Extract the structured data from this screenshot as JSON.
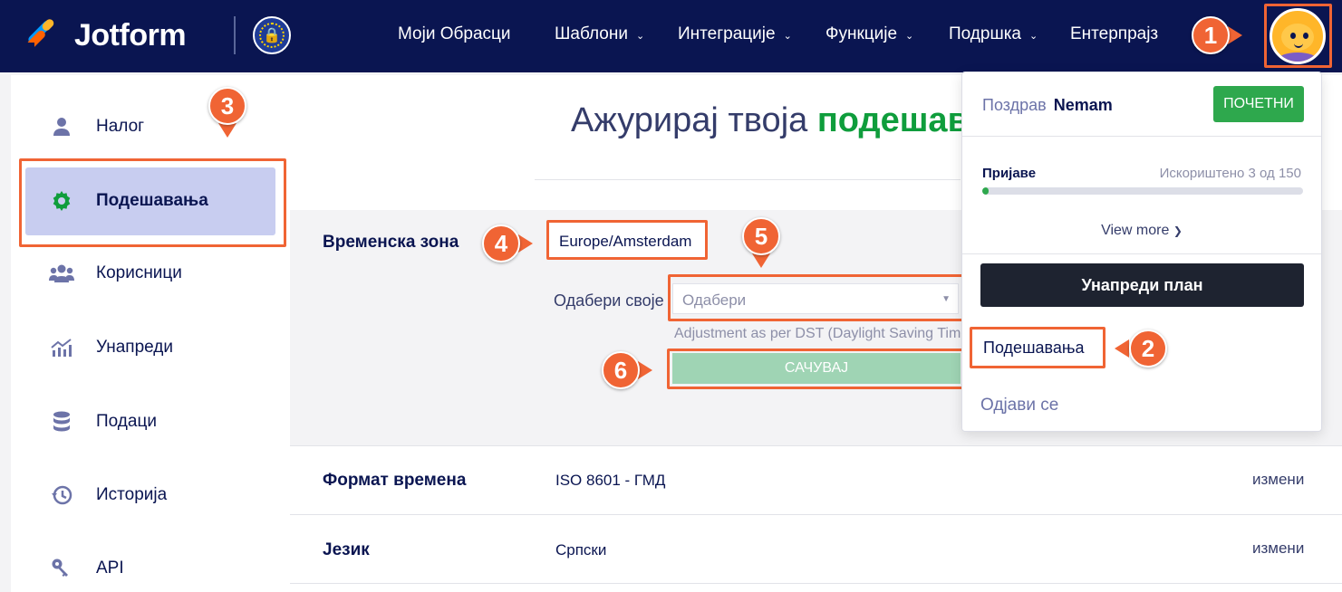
{
  "brand": {
    "name": "Jotform",
    "eu_badge_icon": "lock-icon"
  },
  "nav": {
    "items": [
      {
        "label": "Моји Обрасци",
        "has_dropdown": false
      },
      {
        "label": "Шаблони",
        "has_dropdown": true
      },
      {
        "label": "Интеграције",
        "has_dropdown": true
      },
      {
        "label": "Функције",
        "has_dropdown": true
      },
      {
        "label": "Подршка",
        "has_dropdown": true
      },
      {
        "label": "Ентерпрајз",
        "has_dropdown": false
      }
    ]
  },
  "sidebar": {
    "items": [
      {
        "label": "Налог",
        "icon": "user-icon"
      },
      {
        "label": "Подешавања",
        "icon": "gear-icon",
        "active": true
      },
      {
        "label": "Корисници",
        "icon": "users-icon"
      },
      {
        "label": "Унапреди",
        "icon": "chart-icon"
      },
      {
        "label": "Подаци",
        "icon": "database-icon"
      },
      {
        "label": "Историја",
        "icon": "history-icon"
      },
      {
        "label": "API",
        "icon": "key-icon"
      }
    ]
  },
  "main": {
    "title_prefix": "Ажурирај твоја",
    "title_highlight": "подешавања",
    "timezone": {
      "label": "Временска зона",
      "value": "Europe/Amsterdam",
      "choose_label": "Одабери своје",
      "select_placeholder": "Одабери",
      "dst_note": "Adjustment as per DST (Daylight Saving Time)",
      "save_label": "САЧУВАЈ"
    },
    "rows": [
      {
        "label": "Формат времена",
        "value": "ISO 8601 - ГМД",
        "edit": "измени"
      },
      {
        "label": "Језик",
        "value": "Српски",
        "edit": "измени"
      }
    ]
  },
  "dropdown": {
    "greeting": "Поздрав",
    "username": "Nemam",
    "plan": "ПОЧЕТНИ",
    "submissions_label": "Пријаве",
    "submissions_usage": "Искориштено 3 од 150",
    "usage_fraction": 0.02,
    "view_more": "View more",
    "upgrade": "Унапреди план",
    "settings": "Подешавања",
    "logout": "Одјави се"
  },
  "callouts": [
    "1",
    "2",
    "3",
    "4",
    "5",
    "6"
  ],
  "colors": {
    "nav_bg": "#0a1551",
    "accent": "#f06434",
    "green": "#0f9d3c",
    "active_side": "#c8cdf0"
  }
}
